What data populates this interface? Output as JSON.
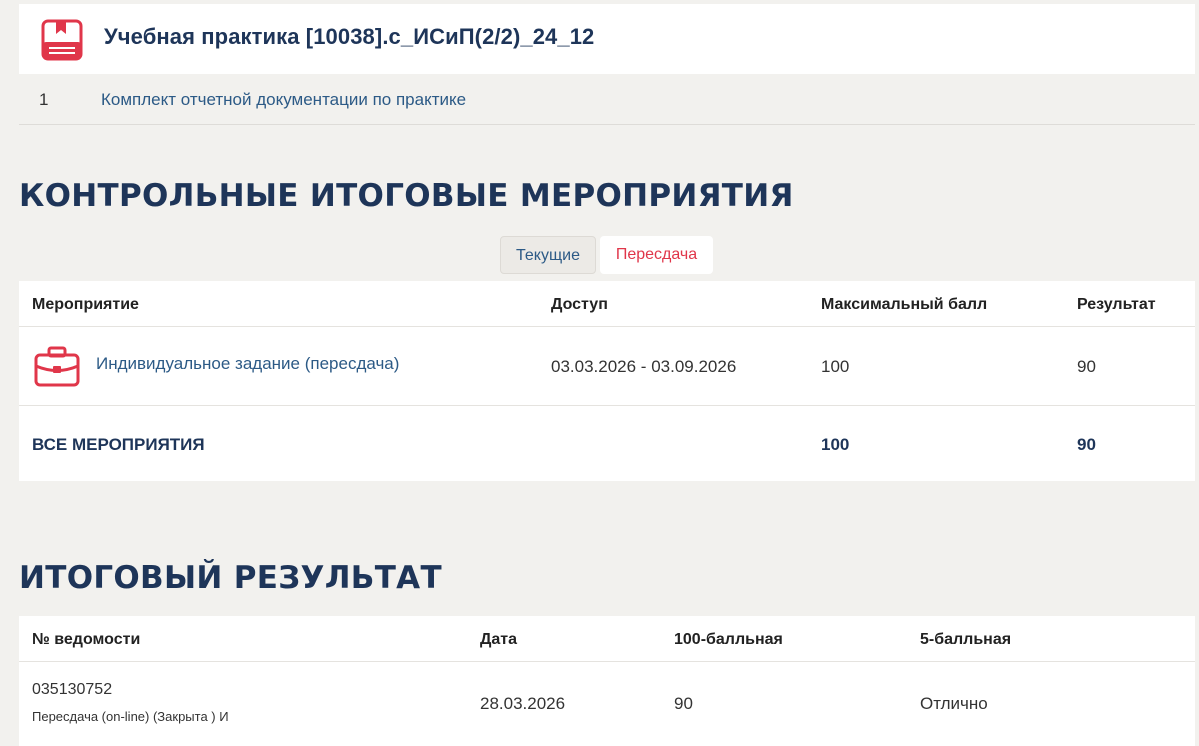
{
  "course": {
    "title": "Учебная практика [10038].с_ИСиП(2/2)_24_12",
    "icon": "notebook-icon",
    "icon_color": "#e0364a"
  },
  "documents": [
    {
      "num": "1",
      "label": "Комплект отчетной документации по практике"
    }
  ],
  "control": {
    "heading": "КОНТРОЛЬНЫЕ ИТОГОВЫЕ МЕРОПРИЯТИЯ",
    "tabs": [
      {
        "label": "Текущие",
        "active": false
      },
      {
        "label": "Пересдача",
        "active": true
      }
    ],
    "columns": [
      "Мероприятие",
      "Доступ",
      "Максимальный балл",
      "Результат"
    ],
    "rows": [
      {
        "icon": "briefcase-icon",
        "name": "Индивидуальное задание (пересдача)",
        "access": "03.03.2026 - 03.09.2026",
        "max": "100",
        "result": "90"
      }
    ],
    "total": {
      "label": "ВСЕ МЕРОПРИЯТИЯ",
      "max": "100",
      "result": "90"
    }
  },
  "final": {
    "heading": "ИТОГОВЫЙ РЕЗУЛЬТАТ",
    "columns": [
      "№ ведомости",
      "Дата",
      "100-балльная",
      "5-балльная"
    ],
    "rows": [
      {
        "number": "035130752",
        "note": "Пересдача (on-line) (Закрыта ) И",
        "date": "28.03.2026",
        "score100": "90",
        "score5": "Отлично"
      }
    ]
  },
  "colors": {
    "accent": "#e0364a",
    "heading": "#1e3559",
    "link": "#2c5a86",
    "background": "#f2f1ee"
  }
}
